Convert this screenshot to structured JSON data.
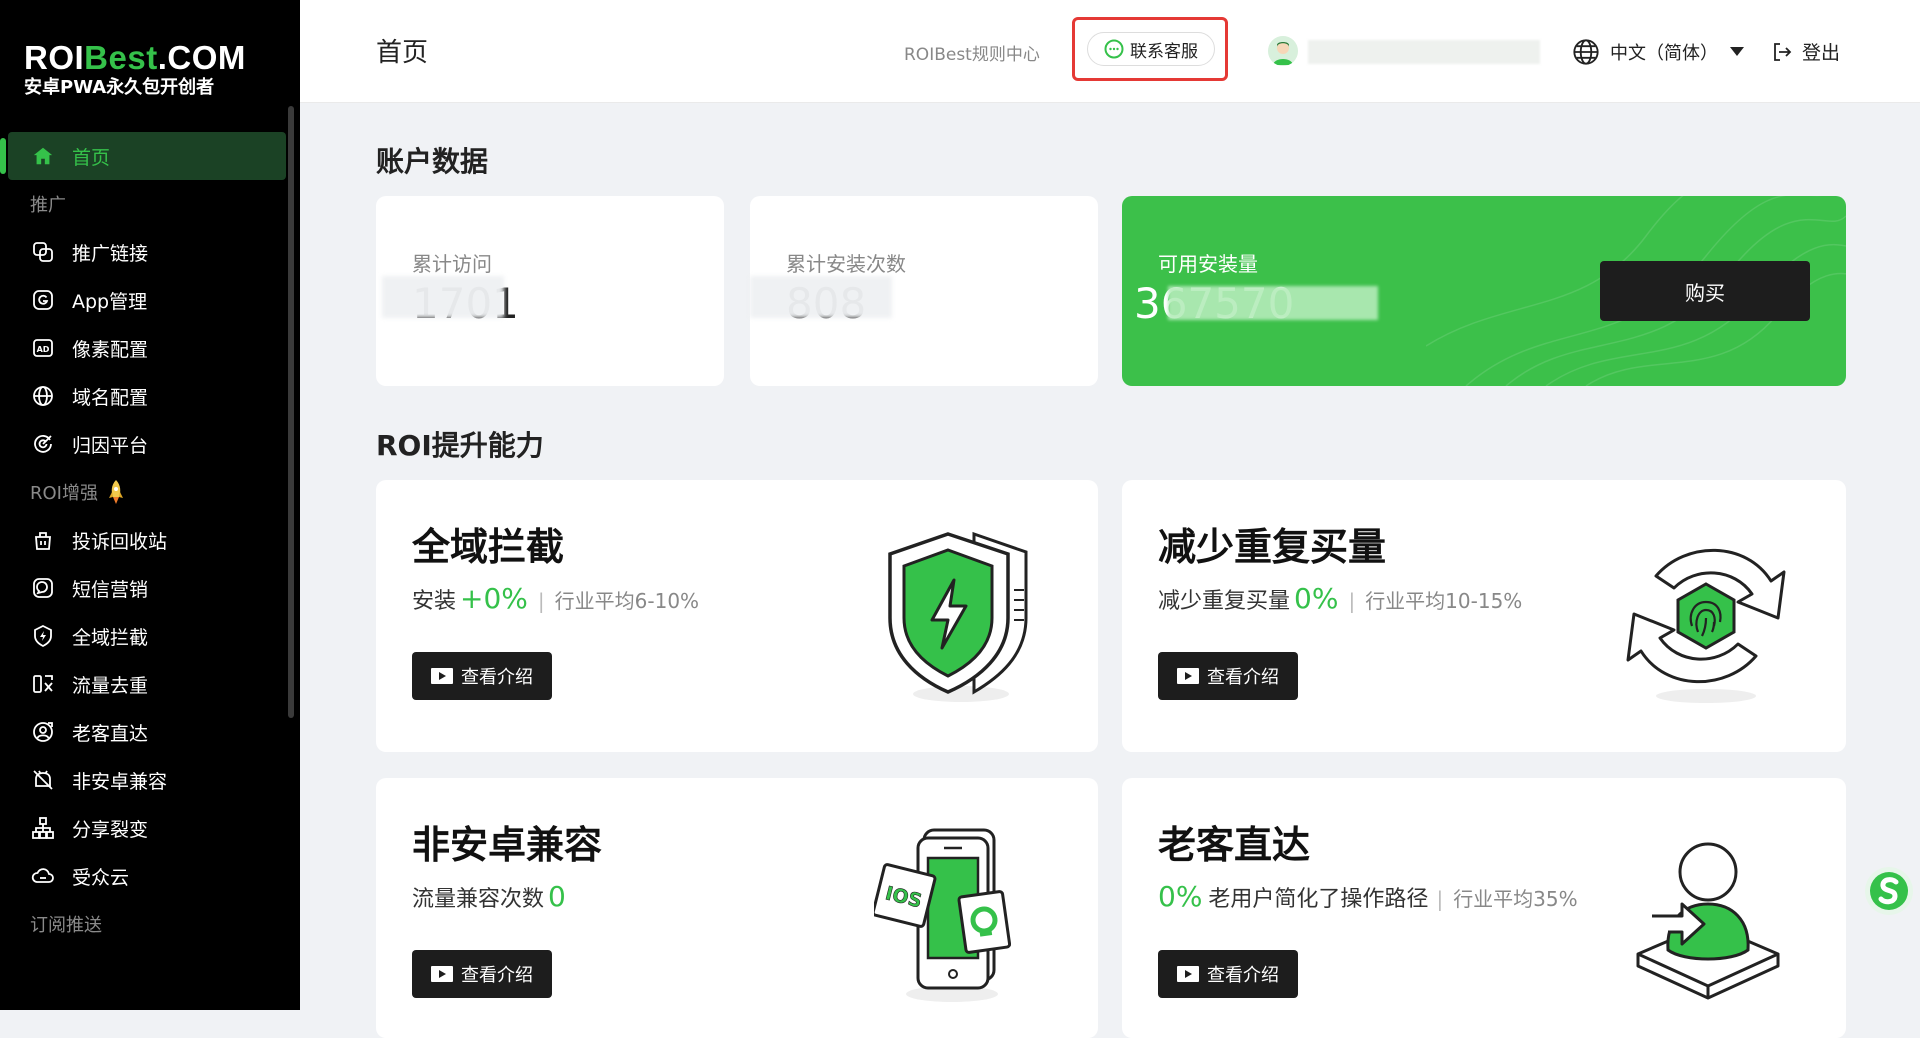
{
  "brand": {
    "title_a": "ROI",
    "title_b": "Best",
    "title_c": ".COM",
    "subtitle": "安卓PWA永久包开创者"
  },
  "sidebar": {
    "home": "首页",
    "section_promo": "推广",
    "promo_items": [
      "推广链接",
      "App管理",
      "像素配置",
      "域名配置",
      "归因平台"
    ],
    "section_roi": "ROI增强",
    "roi_items": [
      "投诉回收站",
      "短信营销",
      "全域拦截",
      "流量去重",
      "老客直达",
      "非安卓兼容",
      "分享裂变",
      "受众云"
    ],
    "section_sub": "订阅推送"
  },
  "header": {
    "page_title": "首页",
    "rules_link": "ROIBest规则中心",
    "contact": "联系客服",
    "language": "中文（简体）",
    "logout": "登出"
  },
  "account": {
    "section_title": "账户数据",
    "total_visits_label": "累计访问",
    "total_visits_value": "1701",
    "total_installs_label": "累计安装次数",
    "total_installs_value": "808",
    "available_label": "可用安装量",
    "available_value": "367570",
    "buy_label": "购买"
  },
  "roi": {
    "section_title": "ROI提升能力",
    "cards": [
      {
        "title": "全域拦截",
        "metric_label": "安装",
        "metric_value": "+0%",
        "avg": "行业平均6-10%",
        "button": "查看介绍"
      },
      {
        "title": "减少重复买量",
        "metric_label": "减少重复买量",
        "metric_value": "0%",
        "avg": "行业平均10-15%",
        "button": "查看介绍"
      },
      {
        "title": "非安卓兼容",
        "metric_label": "流量兼容次数",
        "metric_value": "0",
        "button": "查看介绍"
      },
      {
        "title": "老客直达",
        "metric_value": "0%",
        "metric_label": "老用户简化了操作路径",
        "avg": "行业平均35%",
        "button": "查看介绍"
      }
    ]
  },
  "illustration_text": {
    "ios": "IOS"
  },
  "colors": {
    "accent": "#35c14a",
    "sidebar_bg": "#000000",
    "highlight": "#e53935"
  }
}
